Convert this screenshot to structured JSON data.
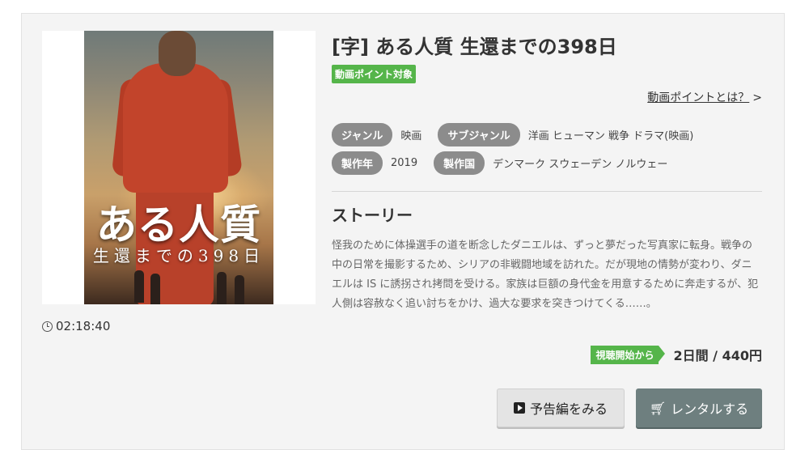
{
  "title": "[字] ある人質 生還までの398日",
  "badge": "動画ポイント対象",
  "points_link": "動画ポイントとは？",
  "points_arrow": ">",
  "meta": {
    "genre_label": "ジャンル",
    "genre_value": "映画",
    "subgenre_label": "サブジャンル",
    "subgenre_value": "洋画 ヒューマン 戦争 ドラマ(映画)",
    "year_label": "製作年",
    "year_value": "2019",
    "country_label": "製作国",
    "country_value": "デンマーク スウェーデン ノルウェー"
  },
  "poster": {
    "title": "ある人質",
    "subtitle": "生還までの398日"
  },
  "duration": "02:18:40",
  "story": {
    "heading": "ストーリー",
    "text": "怪我のために体操選手の道を断念したダニエルは、ずっと夢だった写真家に転身。戦争の中の日常を撮影するため、シリアの非戦闘地域を訪れた。だが現地の情勢が変わり、ダニエルは IS に誘拐され拷問を受ける。家族は巨額の身代金を用意するために奔走するが、犯人側は容赦なく追い討ちをかけ、過大な要求を突きつけてくる……。"
  },
  "price": {
    "badge": "視聴開始から",
    "text": "2日間 / 440円"
  },
  "buttons": {
    "trailer": "予告編をみる",
    "rental": "レンタルする"
  },
  "colors": {
    "accent_green": "#55b54a",
    "pill_gray": "#8c8c8c",
    "rental_button": "#6e7f7f"
  },
  "icons": {
    "clock": "clock-icon",
    "play": "play-icon",
    "cart": "cart-icon"
  }
}
